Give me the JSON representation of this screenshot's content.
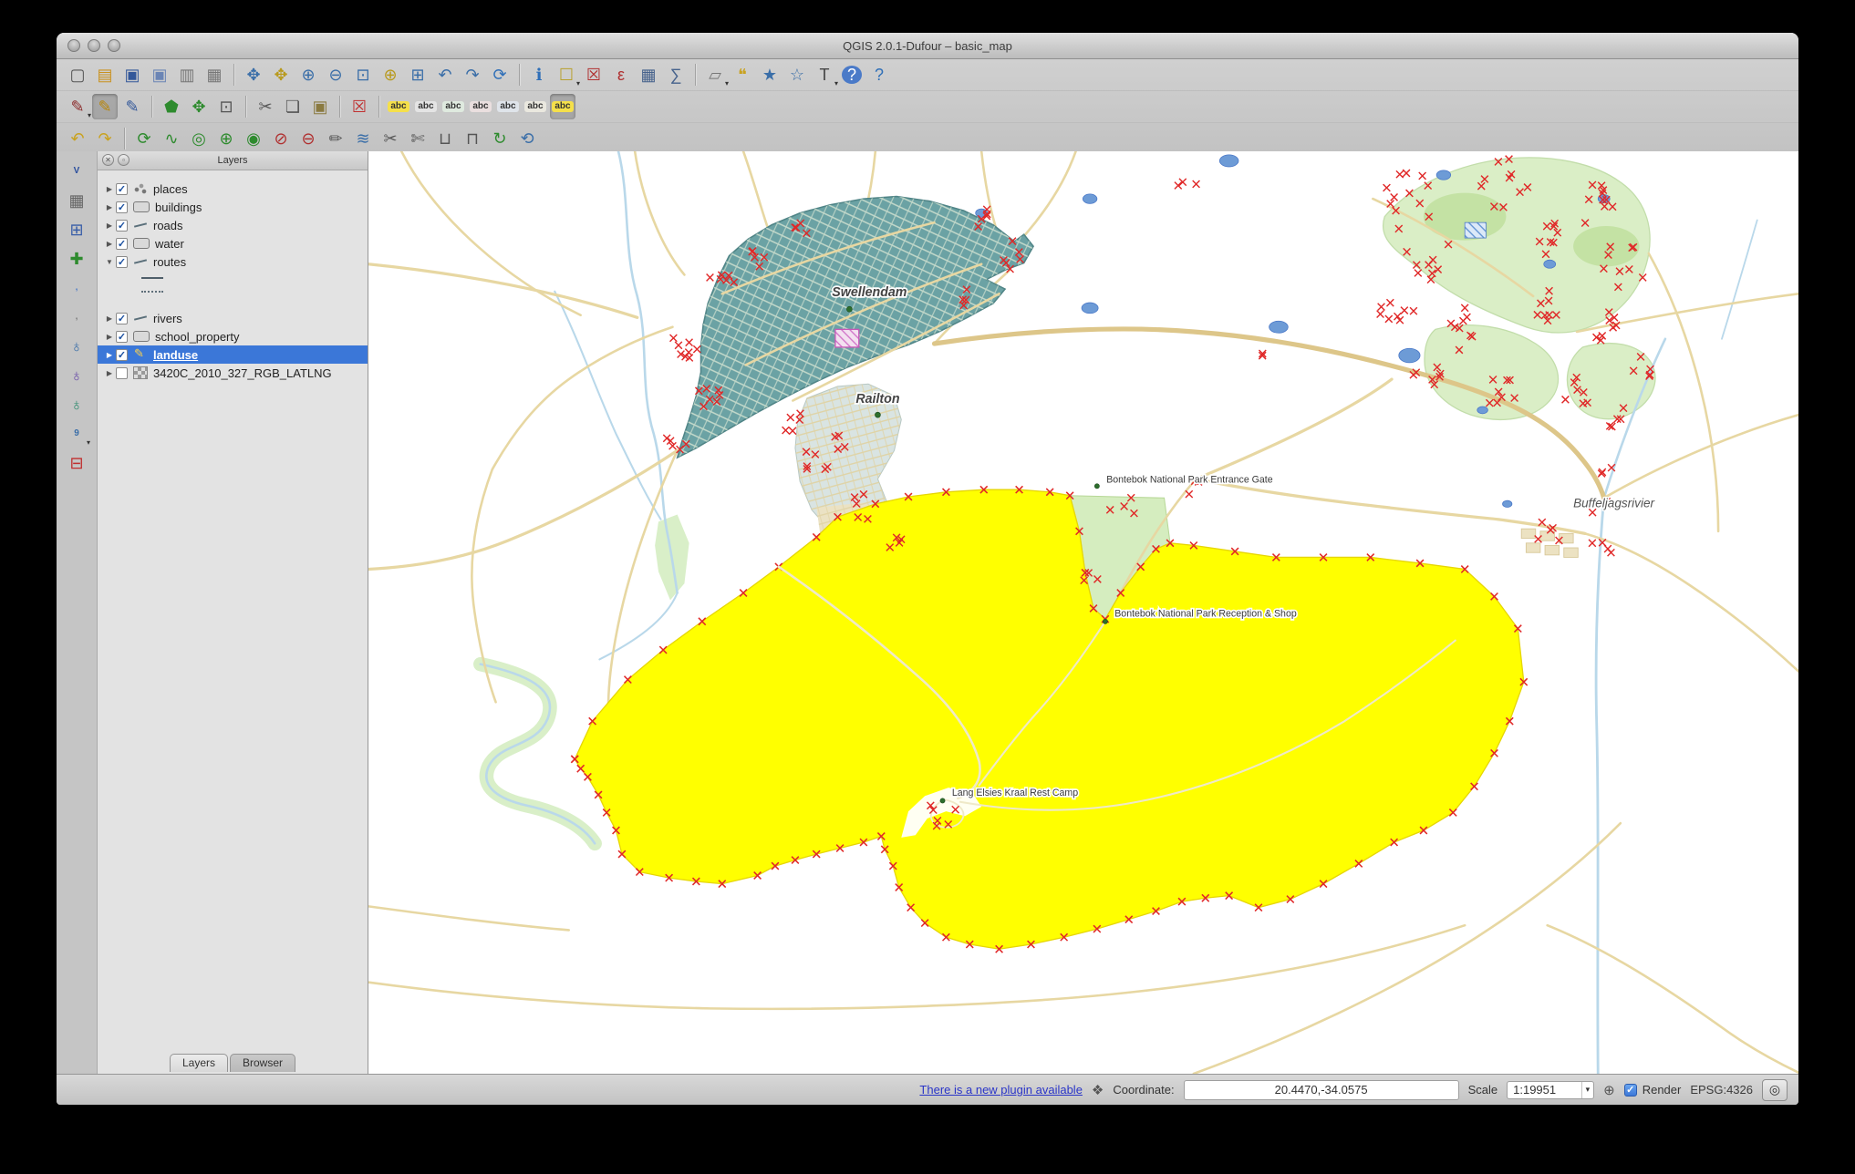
{
  "window": {
    "title": "QGIS 2.0.1-Dufour – basic_map"
  },
  "toolbars": {
    "row1": [
      {
        "name": "new-project-icon",
        "glyph": "▢",
        "color": "#555"
      },
      {
        "name": "open-project-icon",
        "glyph": "▤",
        "color": "#c9921f"
      },
      {
        "name": "save-project-icon",
        "glyph": "▣",
        "color": "#33589a"
      },
      {
        "name": "save-project-as-icon",
        "glyph": "▣",
        "color": "#6b85b5"
      },
      {
        "name": "new-print-composer-icon",
        "glyph": "▥",
        "color": "#777"
      },
      {
        "name": "composer-manager-icon",
        "glyph": "▦",
        "color": "#777"
      },
      {
        "sep": true
      },
      {
        "name": "pan-map-icon",
        "glyph": "✥",
        "color": "#3a6ea8"
      },
      {
        "name": "pan-to-selection-icon",
        "glyph": "✥",
        "color": "#b89a1e"
      },
      {
        "name": "zoom-in-icon",
        "glyph": "⊕",
        "color": "#3a6ea8"
      },
      {
        "name": "zoom-out-icon",
        "glyph": "⊖",
        "color": "#3a6ea8"
      },
      {
        "name": "zoom-full-icon",
        "glyph": "⊡",
        "color": "#3a6ea8"
      },
      {
        "name": "zoom-to-selection-icon",
        "glyph": "⊕",
        "color": "#b89a1e"
      },
      {
        "name": "zoom-to-layer-icon",
        "glyph": "⊞",
        "color": "#3a6ea8"
      },
      {
        "name": "zoom-last-icon",
        "glyph": "↶",
        "color": "#3a6ea8"
      },
      {
        "name": "zoom-next-icon",
        "glyph": "↷",
        "color": "#3a6ea8"
      },
      {
        "name": "refresh-map-icon",
        "glyph": "⟳",
        "color": "#2f6fb8"
      },
      {
        "sep": true
      },
      {
        "name": "identify-features-icon",
        "glyph": "ℹ",
        "color": "#2f6fb8"
      },
      {
        "name": "select-features-icon",
        "glyph": "☐",
        "color": "#b8a12e",
        "caret": true
      },
      {
        "name": "deselect-features-icon",
        "glyph": "☒",
        "color": "#b03030"
      },
      {
        "name": "select-by-expression-icon",
        "glyph": "ε",
        "color": "#b03030"
      },
      {
        "name": "open-attribute-table-icon",
        "glyph": "▦",
        "color": "#46628c"
      },
      {
        "name": "field-calculator-icon",
        "glyph": "∑",
        "color": "#46628c"
      },
      {
        "sep": true
      },
      {
        "name": "measure-icon",
        "glyph": "▱",
        "color": "#777",
        "caret": true
      },
      {
        "name": "map-tips-icon",
        "glyph": "❝",
        "color": "#c9a21f"
      },
      {
        "name": "new-bookmark-icon",
        "glyph": "★",
        "color": "#3a6ea8"
      },
      {
        "name": "show-bookmarks-icon",
        "glyph": "☆",
        "color": "#3a6ea8"
      },
      {
        "name": "text-annotation-icon",
        "glyph": "T",
        "color": "#444",
        "caret": true
      },
      {
        "name": "help-icon",
        "glyph": "?",
        "color": "#fff",
        "bg": "#4a7ac8",
        "round": true
      },
      {
        "name": "whats-this-icon",
        "glyph": "?",
        "color": "#2f6fb8"
      }
    ],
    "row2": [
      {
        "name": "current-edits-icon",
        "glyph": "✎",
        "color": "#8b2b2b",
        "caret": true
      },
      {
        "name": "toggle-editing-icon",
        "glyph": "✎",
        "color": "#b8860b",
        "active": true
      },
      {
        "name": "save-layer-edits-icon",
        "glyph": "✎",
        "color": "#33589a"
      },
      {
        "sep": true
      },
      {
        "name": "add-feature-icon",
        "glyph": "⬟",
        "color": "#2e8b2e"
      },
      {
        "name": "move-feature-icon",
        "glyph": "✥",
        "color": "#2e8b2e"
      },
      {
        "name": "node-tool-icon",
        "glyph": "⊡",
        "color": "#555"
      },
      {
        "sep": true
      },
      {
        "name": "cut-features-icon",
        "glyph": "✂",
        "color": "#555"
      },
      {
        "name": "copy-features-icon",
        "glyph": "❏",
        "color": "#555"
      },
      {
        "name": "paste-features-icon",
        "glyph": "▣",
        "color": "#8a7a40"
      },
      {
        "sep": true
      },
      {
        "name": "delete-selected-icon",
        "glyph": "☒",
        "color": "#c03030"
      },
      {
        "sep": true
      },
      {
        "name": "labeling-icon",
        "glyph": "abc",
        "text": true,
        "color": "#333",
        "bg": "#f5e04a"
      },
      {
        "name": "label-options-icon",
        "glyph": "abc",
        "text": true,
        "color": "#333",
        "bg": "#e4e4e4"
      },
      {
        "name": "pin-labels-icon",
        "glyph": "abc",
        "text": true,
        "color": "#333",
        "bg": "#dfeadf"
      },
      {
        "name": "highlight-pinned-labels-icon",
        "glyph": "abc",
        "text": true,
        "color": "#333",
        "bg": "#eadfdf"
      },
      {
        "name": "move-label-icon",
        "glyph": "abc",
        "text": true,
        "color": "#333",
        "bg": "#dfe4ea"
      },
      {
        "name": "rotate-label-icon",
        "glyph": "abc",
        "text": true,
        "color": "#333",
        "bg": "#eae8df"
      },
      {
        "name": "change-label-icon",
        "glyph": "abc",
        "text": true,
        "color": "#333",
        "bg": "#f5e04a",
        "active": true
      }
    ],
    "row3": [
      {
        "name": "undo-icon",
        "glyph": "↶",
        "color": "#c9a21f"
      },
      {
        "name": "redo-icon",
        "glyph": "↷",
        "color": "#c9a21f"
      },
      {
        "sep": true
      },
      {
        "name": "rotate-feature-icon",
        "glyph": "⟳",
        "color": "#2e8b2e"
      },
      {
        "name": "simplify-feature-icon",
        "glyph": "∿",
        "color": "#2e8b2e"
      },
      {
        "name": "add-ring-icon",
        "glyph": "◎",
        "color": "#2e8b2e"
      },
      {
        "name": "add-part-icon",
        "glyph": "⊕",
        "color": "#2e8b2e"
      },
      {
        "name": "fill-ring-icon",
        "glyph": "◉",
        "color": "#2e8b2e"
      },
      {
        "name": "delete-ring-icon",
        "glyph": "⊘",
        "color": "#b03030"
      },
      {
        "name": "delete-part-icon",
        "glyph": "⊖",
        "color": "#b03030"
      },
      {
        "name": "reshape-features-icon",
        "glyph": "✏",
        "color": "#555"
      },
      {
        "name": "offset-curve-icon",
        "glyph": "≋",
        "color": "#3a6ea8"
      },
      {
        "name": "split-features-icon",
        "glyph": "✂",
        "color": "#555"
      },
      {
        "name": "split-parts-icon",
        "glyph": "✄",
        "color": "#555"
      },
      {
        "name": "merge-features-icon",
        "glyph": "⊔",
        "color": "#555"
      },
      {
        "name": "merge-attributes-icon",
        "glyph": "⊓",
        "color": "#555"
      },
      {
        "name": "rotate-point-symbols-icon",
        "glyph": "↻",
        "color": "#2e8b2e"
      },
      {
        "name": "redraw-icon",
        "glyph": "⟲",
        "color": "#3a6ea8"
      }
    ],
    "left": [
      {
        "name": "add-vector-layer-icon",
        "glyph": "V",
        "text": true,
        "color": "#2b4f9e"
      },
      {
        "name": "add-raster-layer-icon",
        "glyph": "▦",
        "color": "#666"
      },
      {
        "name": "add-postgis-layer-icon",
        "glyph": "⊞",
        "color": "#3a5fa8"
      },
      {
        "name": "new-shapefile-layer-icon",
        "glyph": "✚",
        "color": "#2e8b2e"
      },
      {
        "name": "add-spatialite-layer-icon",
        "glyph": ",",
        "text": true,
        "color": "#4a7ac8"
      },
      {
        "name": "add-delimited-text-layer-icon",
        "glyph": ",",
        "text": true,
        "color": "#7a7a7a"
      },
      {
        "name": "add-wms-layer-icon",
        "glyph": "♁",
        "color": "#3a6ea8"
      },
      {
        "name": "add-wcs-layer-icon",
        "glyph": "♁",
        "color": "#6a4ea8"
      },
      {
        "name": "add-wfs-layer-icon",
        "glyph": "♁",
        "color": "#2e8b6e"
      },
      {
        "name": "add-gps-layer-icon",
        "glyph": "9",
        "text": true,
        "color": "#3a6ea8",
        "caret": true
      },
      {
        "name": "remove-layer-icon",
        "glyph": "⊟",
        "color": "#c03030"
      }
    ]
  },
  "layers_panel": {
    "title": "Layers",
    "items": [
      {
        "label": "places",
        "checked": true,
        "expanded": false,
        "selected": false,
        "type": "point"
      },
      {
        "label": "buildings",
        "checked": true,
        "expanded": false,
        "selected": false,
        "type": "polygon"
      },
      {
        "label": "roads",
        "checked": true,
        "expanded": false,
        "selected": false,
        "type": "line"
      },
      {
        "label": "water",
        "checked": true,
        "expanded": false,
        "selected": false,
        "type": "polygon"
      },
      {
        "label": "routes",
        "checked": true,
        "expanded": true,
        "selected": false,
        "type": "line",
        "children": [
          "dash",
          "dot"
        ]
      },
      {
        "label": "rivers",
        "checked": true,
        "expanded": false,
        "selected": false,
        "type": "line"
      },
      {
        "label": "school_property",
        "checked": true,
        "expanded": false,
        "selected": false,
        "type": "polygon"
      },
      {
        "label": "landuse",
        "checked": true,
        "expanded": false,
        "selected": true,
        "type": "pencil"
      },
      {
        "label": "3420C_2010_327_RGB_LATLNG",
        "checked": false,
        "expanded": false,
        "selected": false,
        "type": "raster"
      }
    ],
    "tabs": [
      {
        "label": "Layers",
        "active": true
      },
      {
        "label": "Browser",
        "active": false
      }
    ]
  },
  "map": {
    "labels": {
      "swellendam": "Swellendam",
      "railton": "Railton",
      "entrance_gate": "Bontebok National Park Entrance Gate",
      "reception": "Bontebok National Park Reception & Shop",
      "rest_camp": "Lang Elsies Kraal Rest Camp",
      "buffeljagsrivier": "Buffeljagsrivier"
    }
  },
  "status_bar": {
    "plugin_link": "There is a new plugin available",
    "coordinate_label": "Coordinate:",
    "coordinate_value": "20.4470,-34.0575",
    "scale_label": "Scale",
    "scale_value": "1:19951",
    "render_label": "Render",
    "render_checked": "✓",
    "crs": "EPSG:4326"
  },
  "colors": {
    "selection_blue": "#3b77d8",
    "landuse_yellow": "#ffff00",
    "park_green": "#daeec6",
    "urban_teal": "#6ba2a4",
    "vertex_red": "#e02828",
    "road_tan": "#e7d7a2",
    "water_blue": "#b9d8ea"
  }
}
